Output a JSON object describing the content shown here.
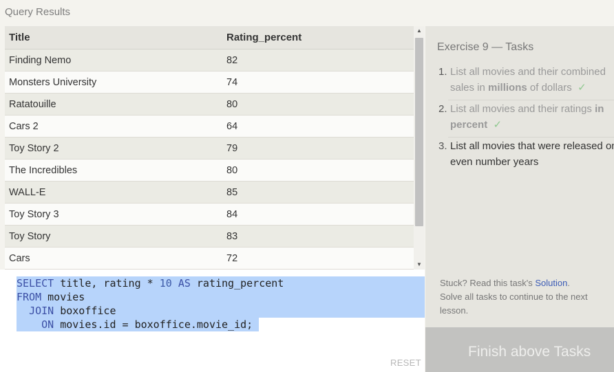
{
  "header": {
    "title": "Query Results"
  },
  "results": {
    "columns": [
      "Title",
      "Rating_percent"
    ],
    "rows": [
      [
        "Finding Nemo",
        "82"
      ],
      [
        "Monsters University",
        "74"
      ],
      [
        "Ratatouille",
        "80"
      ],
      [
        "Cars 2",
        "64"
      ],
      [
        "Toy Story 2",
        "79"
      ],
      [
        "The Incredibles",
        "80"
      ],
      [
        "WALL-E",
        "85"
      ],
      [
        "Toy Story 3",
        "84"
      ],
      [
        "Toy Story",
        "83"
      ],
      [
        "Cars",
        "72"
      ]
    ]
  },
  "editor": {
    "lines": [
      [
        "SELECT",
        " title, rating ",
        "*",
        " ",
        "10",
        " ",
        "AS",
        " rating_percent"
      ],
      [
        "FROM",
        " movies"
      ],
      [
        "  ",
        "JOIN",
        " boxoffice"
      ],
      [
        "    ",
        "ON",
        " movies.id ",
        "=",
        " boxoffice.movie_id;"
      ]
    ],
    "reset_label": "RESET"
  },
  "exercise": {
    "title": "Exercise 9 — Tasks",
    "tasks": [
      {
        "number": "1.",
        "line1": "List all movies and their combined",
        "line2_pre": "sales in ",
        "line2_bold": "millions",
        "line2_post": " of dollars",
        "check": "✓"
      },
      {
        "number": "2.",
        "line1_pre": "List all movies and their ratings ",
        "line1_bold": "in",
        "line2_bold": "percent",
        "check": "✓"
      },
      {
        "number": "3.",
        "line1": "List all movies that were released on",
        "line2": "even number years"
      }
    ],
    "stuck_pre": "Stuck? Read this task's ",
    "solution_link": "Solution",
    "stuck_post": ".",
    "stuck_line2": "Solve all tasks to continue to the next lesson.",
    "finish_label": "Finish above Tasks"
  }
}
